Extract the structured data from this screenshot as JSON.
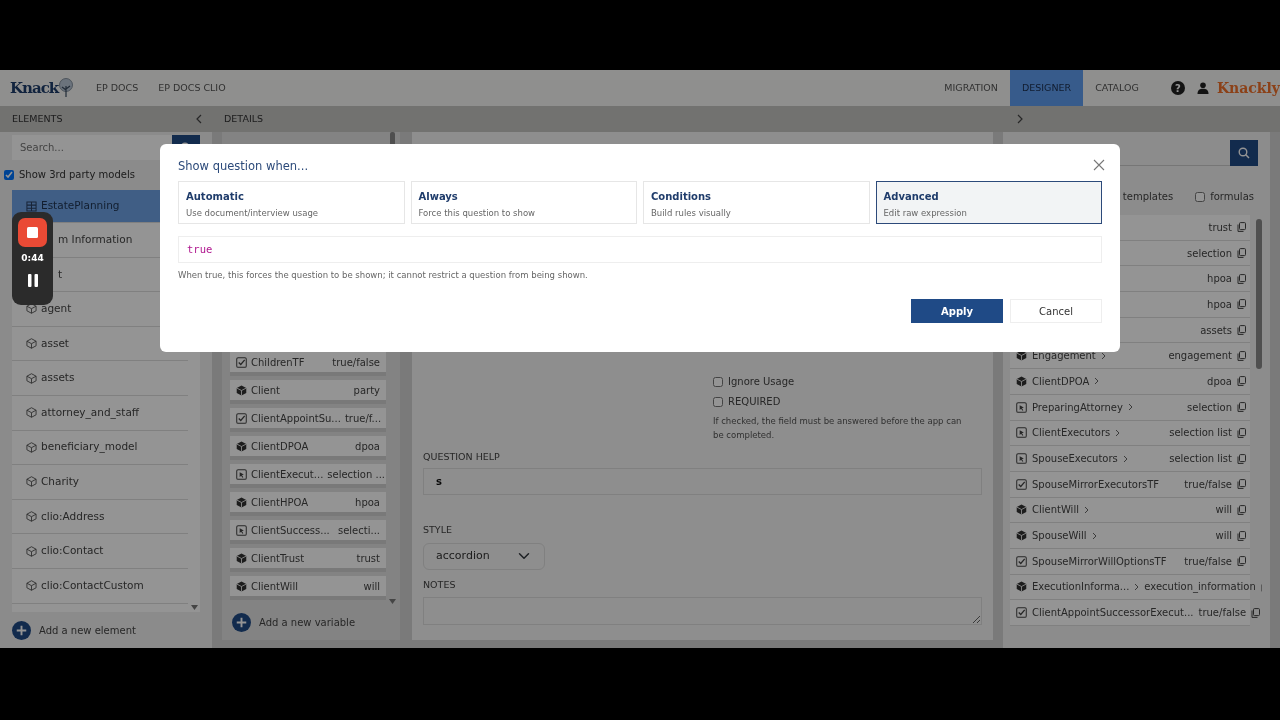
{
  "navbar": {
    "logo": "Knack",
    "links": [
      {
        "label": "EP DOCS",
        "selected": false
      },
      {
        "label": "EP DOCS CLIO",
        "selected": false
      }
    ],
    "right_links": [
      {
        "label": "MIGRATION",
        "selected": false
      },
      {
        "label": "DESIGNER",
        "selected": true
      },
      {
        "label": "CATALOG",
        "selected": false
      }
    ],
    "help_icon": "?",
    "brand": "Knackly"
  },
  "elements_panel": {
    "title": "ELEMENTS",
    "search_placeholder": "Search...",
    "show_3rd_party": {
      "label": "Show 3rd party models",
      "checked": true
    },
    "items": [
      {
        "label": "EstatePlanning",
        "kind": "dataset",
        "selected": true
      },
      {
        "label": "m Information",
        "kind": "covered",
        "selected": false
      },
      {
        "label": "t",
        "kind": "covered",
        "selected": false
      },
      {
        "label": "agent",
        "kind": "model",
        "selected": false
      },
      {
        "label": "asset",
        "kind": "model",
        "selected": false
      },
      {
        "label": "assets",
        "kind": "model",
        "selected": false
      },
      {
        "label": "attorney_and_staff",
        "kind": "model",
        "selected": false
      },
      {
        "label": "beneficiary_model",
        "kind": "model",
        "selected": false
      },
      {
        "label": "Charity",
        "kind": "model",
        "selected": false
      },
      {
        "label": "clio:Address",
        "kind": "model",
        "selected": false
      },
      {
        "label": "clio:Contact",
        "kind": "model",
        "selected": false
      },
      {
        "label": "clio:ContactCustom",
        "kind": "model",
        "selected": false
      }
    ],
    "add_label": "Add a new element"
  },
  "details_panel": {
    "title": "DETAILS",
    "variables": [
      {
        "name": "ChildrenTF",
        "type": "true/false",
        "kind": "boolean"
      },
      {
        "name": "Client",
        "type": "party",
        "kind": "object"
      },
      {
        "name": "ClientAppointSu...",
        "type": "true/f...",
        "kind": "boolean"
      },
      {
        "name": "ClientDPOA",
        "type": "dpoa",
        "kind": "object"
      },
      {
        "name": "ClientExecut...",
        "type": "selection ...",
        "kind": "selection"
      },
      {
        "name": "ClientHPOA",
        "type": "hpoa",
        "kind": "object"
      },
      {
        "name": "ClientSuccess...",
        "type": "selecti...",
        "kind": "selection"
      },
      {
        "name": "ClientTrust",
        "type": "trust",
        "kind": "object"
      },
      {
        "name": "ClientWill",
        "type": "will",
        "kind": "object"
      }
    ],
    "add_label": "Add a new variable",
    "ignore_usage": {
      "label": "Ignore Usage",
      "checked": false
    },
    "required": {
      "label": "REQUIRED",
      "checked": false
    },
    "required_help": "If checked, the field must be answered before the app can be completed.",
    "question_help": {
      "label": "QUESTION HELP",
      "value": "s"
    },
    "style": {
      "label": "STYLE",
      "value": "accordion"
    },
    "notes": {
      "label": "NOTES"
    }
  },
  "right_panel": {
    "templates": {
      "label": "templates"
    },
    "formulas": {
      "label": "formulas",
      "checked": false
    },
    "rows": [
      {
        "type": "trust"
      },
      {
        "type": "selection"
      },
      {
        "type": "hpoa"
      },
      {
        "type": "hpoa"
      },
      {
        "type": "assets"
      },
      {
        "name": "Engagement",
        "type": "engagement",
        "kind": "object"
      },
      {
        "name": "ClientDPOA",
        "type": "dpoa",
        "kind": "object"
      },
      {
        "name": "PreparingAttorney",
        "type": "selection",
        "kind": "selection"
      },
      {
        "name": "ClientExecutors",
        "type": "selection list",
        "kind": "selection"
      },
      {
        "name": "SpouseExecutors",
        "type": "selection list",
        "kind": "selection"
      },
      {
        "name": "SpouseMirrorExecutorsTF",
        "type": "true/false",
        "kind": "boolean"
      },
      {
        "name": "ClientWill",
        "type": "will",
        "kind": "object"
      },
      {
        "name": "SpouseWill",
        "type": "will",
        "kind": "object"
      },
      {
        "name": "SpouseMirrorWillOptionsTF",
        "type": "true/false",
        "kind": "boolean"
      },
      {
        "name": "ExecutionInforma...",
        "type": "execution_information",
        "kind": "object"
      },
      {
        "name": "ClientAppointSuccessorExecut...",
        "type": "true/false",
        "kind": "boolean"
      }
    ]
  },
  "modal": {
    "title": "Show question when...",
    "options": [
      {
        "title": "Automatic",
        "subtitle": "Use document/interview usage",
        "selected": false
      },
      {
        "title": "Always",
        "subtitle": "Force this question to show",
        "selected": false
      },
      {
        "title": "Conditions",
        "subtitle": "Build rules visually",
        "selected": false
      },
      {
        "title": "Advanced",
        "subtitle": "Edit raw expression",
        "selected": true
      }
    ],
    "expression": "true",
    "help": "When true, this forces the question to be shown; it cannot restrict a question from being shown.",
    "buttons": [
      {
        "label": "Apply",
        "kind": "primary"
      },
      {
        "label": "Cancel",
        "kind": "secondary"
      }
    ]
  },
  "recorder": {
    "time": "0:44"
  }
}
